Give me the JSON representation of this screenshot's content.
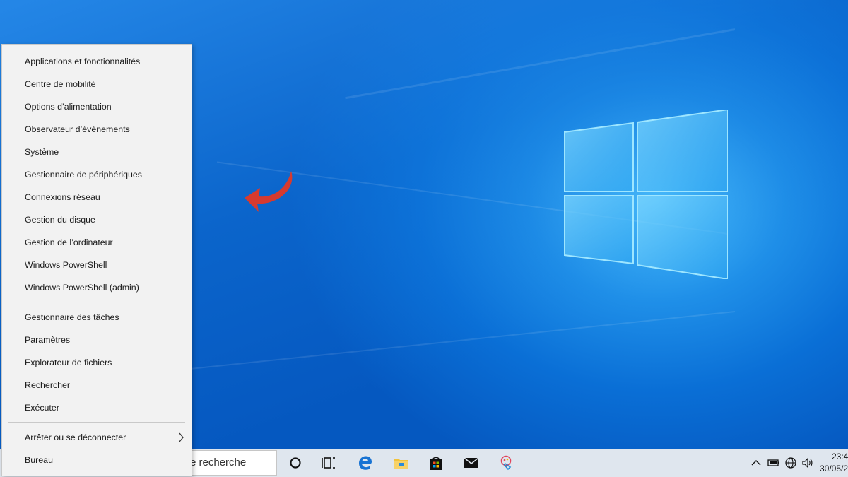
{
  "context_menu": {
    "items": [
      {
        "label": "Applications et fonctionnalités"
      },
      {
        "label": "Centre de mobilité"
      },
      {
        "label": "Options d’alimentation"
      },
      {
        "label": "Observateur d’événements"
      },
      {
        "label": "Système"
      },
      {
        "label": "Gestionnaire de périphériques"
      },
      {
        "label": "Connexions réseau"
      },
      {
        "label": "Gestion du disque"
      },
      {
        "label": "Gestion de l’ordinateur"
      },
      {
        "label": "Windows PowerShell"
      },
      {
        "label": "Windows PowerShell (admin)"
      },
      {
        "label": "Gestionnaire des tâches"
      },
      {
        "label": "Paramètres"
      },
      {
        "label": "Explorateur de fichiers"
      },
      {
        "label": "Rechercher"
      },
      {
        "label": "Exécuter"
      },
      {
        "label": "Arrêter ou se déconnecter"
      },
      {
        "label": "Bureau"
      }
    ]
  },
  "taskbar": {
    "search_text": "e recherche",
    "apps": [
      "cortana-icon",
      "task-view-icon",
      "edge-icon",
      "file-explorer-icon",
      "store-icon",
      "mail-icon",
      "paint-icon"
    ],
    "tray": [
      "chevron-up-icon",
      "battery-icon",
      "network-icon",
      "volume-icon"
    ],
    "clock_time": "23:4",
    "clock_date": "30/05/2"
  },
  "colors": {
    "annotation_arrow": "#d63a2f",
    "desktop_blue": "#0a6fd6",
    "menu_bg": "#f2f2f2",
    "taskbar_bg": "#dfe6ee"
  }
}
